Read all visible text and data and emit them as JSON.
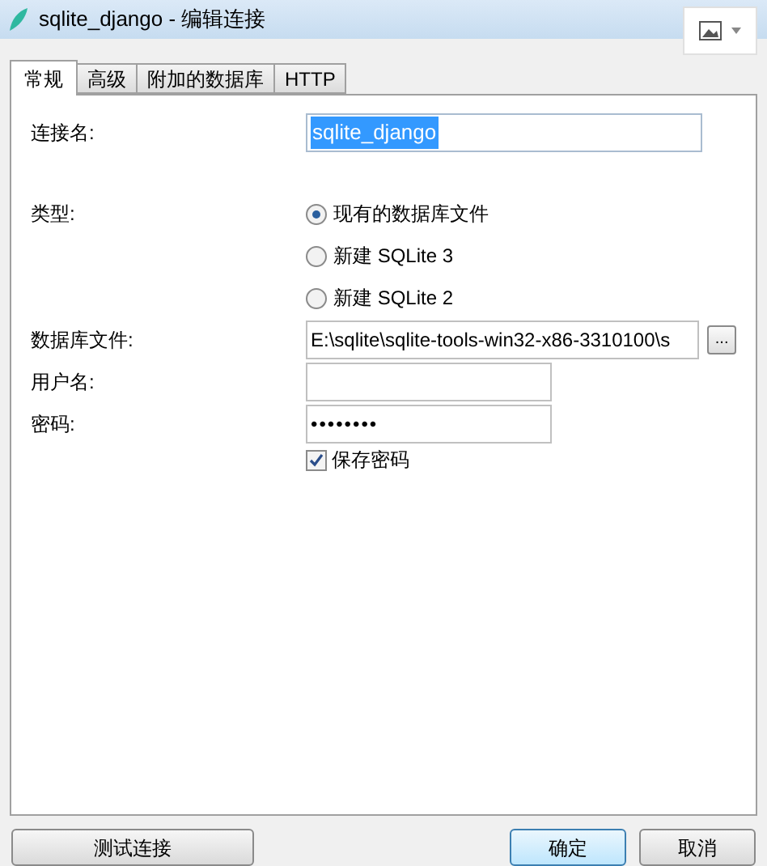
{
  "window": {
    "title": "sqlite_django - 编辑连接"
  },
  "tabs": [
    {
      "label": "常规",
      "selected": true
    },
    {
      "label": "高级",
      "selected": false
    },
    {
      "label": "附加的数据库",
      "selected": false
    },
    {
      "label": "HTTP",
      "selected": false
    }
  ],
  "form": {
    "connection_name": {
      "label": "连接名:",
      "value": "sqlite_django"
    },
    "type": {
      "label": "类型:",
      "options": [
        {
          "label": "现有的数据库文件",
          "selected": true
        },
        {
          "label": "新建 SQLite 3",
          "selected": false
        },
        {
          "label": "新建 SQLite 2",
          "selected": false
        }
      ]
    },
    "database_file": {
      "label": "数据库文件:",
      "value": "E:\\sqlite\\sqlite-tools-win32-x86-3310100\\s",
      "browse": "..."
    },
    "username": {
      "label": "用户名:"
    },
    "password": {
      "label": "密码:",
      "value": "••••••••"
    },
    "save_password": {
      "label": "保存密码",
      "checked": true
    }
  },
  "buttons": {
    "test": "测试连接",
    "ok": "确定",
    "cancel": "取消"
  }
}
